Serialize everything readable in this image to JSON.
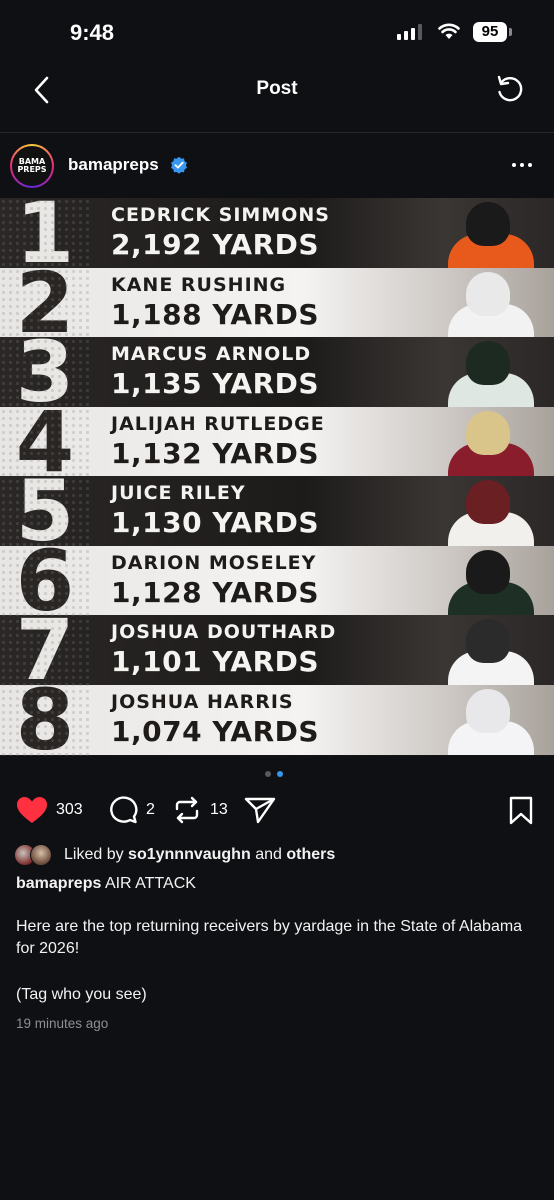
{
  "status_bar": {
    "time": "9:48",
    "battery": "95"
  },
  "nav": {
    "title": "Post"
  },
  "post": {
    "username": "bamapreps",
    "avatar_text_line1": "BAMA",
    "avatar_text_line2": "PREPS",
    "verified": true,
    "rankings": [
      {
        "rank": "1",
        "name": "CEDRICK SIMMONS",
        "yards": "2,192 YARDS"
      },
      {
        "rank": "2",
        "name": "KANE RUSHING",
        "yards": "1,188 YARDS"
      },
      {
        "rank": "3",
        "name": "MARCUS ARNOLD",
        "yards": "1,135 YARDS"
      },
      {
        "rank": "4",
        "name": "JALIJAH RUTLEDGE",
        "yards": "1,132 YARDS"
      },
      {
        "rank": "5",
        "name": "JUICE RILEY",
        "yards": "1,130 YARDS"
      },
      {
        "rank": "6",
        "name": "DARION MOSELEY",
        "yards": "1,128 YARDS"
      },
      {
        "rank": "7",
        "name": "JOSHUA DOUTHARD",
        "yards": "1,101 YARDS"
      },
      {
        "rank": "8",
        "name": "JOSHUA HARRIS",
        "yards": "1,074 YARDS"
      }
    ],
    "carousel": {
      "total": 2,
      "active_index": 1
    },
    "actions": {
      "likes": "303",
      "comments": "2",
      "reposts": "13"
    },
    "liked_by": {
      "prefix": "Liked by",
      "user": "so1ynnnvaughn",
      "conjunction": "and",
      "others": "others"
    },
    "caption": {
      "username": "bamapreps",
      "headline": "AIR ATTACK",
      "body": "Here are the top returning receivers by yardage in the State of Alabama for 2026!",
      "tag_line": "(Tag who you see)"
    },
    "timestamp": "19 minutes ago"
  },
  "colors": {
    "background": "#0f1013",
    "like_red": "#ff3040",
    "carousel_active": "#3897f0",
    "verified_blue": "#3897f0"
  }
}
